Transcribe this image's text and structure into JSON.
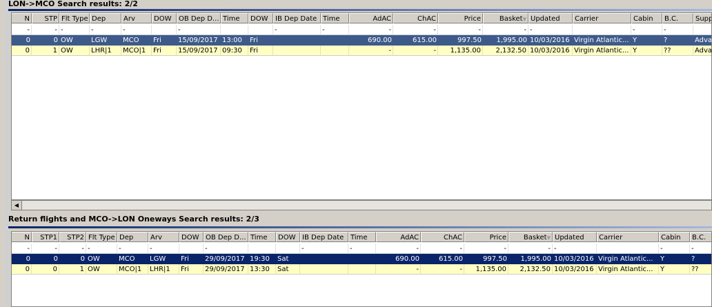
{
  "top": {
    "title": "LON->MCO Search results: 2/2",
    "columns": [
      "N",
      "STP",
      "Flt Type",
      "Dep",
      "Arv",
      "DOW",
      "OB Dep D...",
      "Time",
      "DOW",
      "IB Dep Date",
      "Time",
      "AdAC",
      "ChAC",
      "Price",
      "Basket",
      "Updated",
      "Carrier",
      "Cabin",
      "B.C.",
      "Supp"
    ],
    "filter": [
      "-",
      "-",
      "-",
      "-",
      "-",
      "",
      "-",
      "",
      "",
      "-",
      "-",
      "-",
      "-",
      "-",
      "-",
      "-",
      "",
      "-",
      "-",
      ""
    ],
    "rows": [
      [
        "0",
        "0",
        "OW",
        "LGW",
        "MCO",
        "Fri",
        "15/09/2017",
        "13:00",
        "Fri",
        "",
        "",
        "690.00",
        "615.00",
        "997.50",
        "1,995.00",
        "10/03/2016",
        "Virgin Atlantic...",
        "Y",
        "?",
        "Adva"
      ],
      [
        "0",
        "1",
        "OW",
        "LHR|1",
        "MCO|1",
        "Fri",
        "15/09/2017",
        "09:30",
        "Fri",
        "",
        "",
        "-",
        "-",
        "1,135.00",
        "2,132.50",
        "10/03/2016",
        "Virgin Atlantic...",
        "Y",
        "??",
        "Adva"
      ]
    ],
    "sorted_column": "Basket"
  },
  "bottom": {
    "title": "Return flights and MCO->LON Oneways Search results: 2/3",
    "columns": [
      "N",
      "STP1",
      "STP2",
      "Flt Type",
      "Dep",
      "Arv",
      "DOW",
      "OB Dep D...",
      "Time",
      "DOW",
      "IB Dep Date",
      "Time",
      "AdAC",
      "ChAC",
      "Price",
      "Basket",
      "Updated",
      "Carrier",
      "Cabin",
      "B.C."
    ],
    "filter": [
      "-",
      "-",
      "-",
      "-",
      "-",
      "-",
      "",
      "-",
      "",
      "",
      "-",
      "-",
      "-",
      "-",
      "-",
      "-",
      "-",
      "",
      "-",
      "-"
    ],
    "rows": [
      [
        "0",
        "0",
        "0",
        "OW",
        "MCO",
        "LGW",
        "Fri",
        "29/09/2017",
        "19:30",
        "Sat",
        "",
        "",
        "690.00",
        "615.00",
        "997.50",
        "1,995.00",
        "10/03/2016",
        "Virgin Atlantic...",
        "Y",
        "?"
      ],
      [
        "0",
        "0",
        "1",
        "OW",
        "MCO|1",
        "LHR|1",
        "Fri",
        "29/09/2017",
        "13:30",
        "Sat",
        "",
        "",
        "-",
        "-",
        "1,135.00",
        "2,132.50",
        "10/03/2016",
        "Virgin Atlantic...",
        "Y",
        "??"
      ]
    ],
    "sorted_column": "Basket"
  },
  "colors": {
    "selected_inactive": "#3d5a8a",
    "selected_active": "#0a246a",
    "row_highlight": "#ffffc4"
  }
}
